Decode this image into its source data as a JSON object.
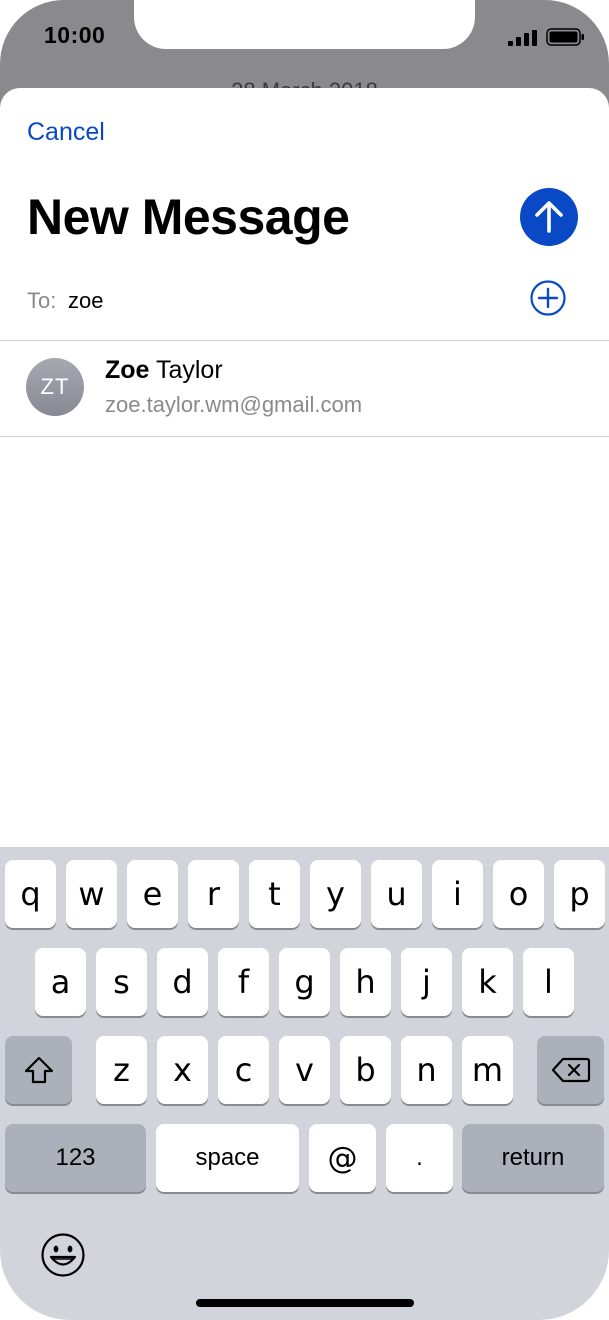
{
  "status_bar": {
    "time": "10:00"
  },
  "background": {
    "date_peek": "28 March 2018"
  },
  "compose": {
    "cancel_label": "Cancel",
    "title": "New Message",
    "to_label": "To:",
    "to_value": "zoe"
  },
  "suggestion": {
    "initials": "ZT",
    "first_name": "Zoe",
    "last_name": "Taylor",
    "email": "zoe.taylor.wm@gmail.com"
  },
  "keyboard": {
    "row1": [
      "q",
      "w",
      "e",
      "r",
      "t",
      "y",
      "u",
      "i",
      "o",
      "p"
    ],
    "row2": [
      "a",
      "s",
      "d",
      "f",
      "g",
      "h",
      "j",
      "k",
      "l"
    ],
    "row3": [
      "z",
      "x",
      "c",
      "v",
      "b",
      "n",
      "m"
    ],
    "numbers_label": "123",
    "space_label": "space",
    "at_label": "@",
    "dot_label": ".",
    "return_label": "return"
  },
  "colors": {
    "accent": "#0a49c6",
    "keyboard_bg": "#d1d4db",
    "dark_key": "#abb0ba"
  }
}
